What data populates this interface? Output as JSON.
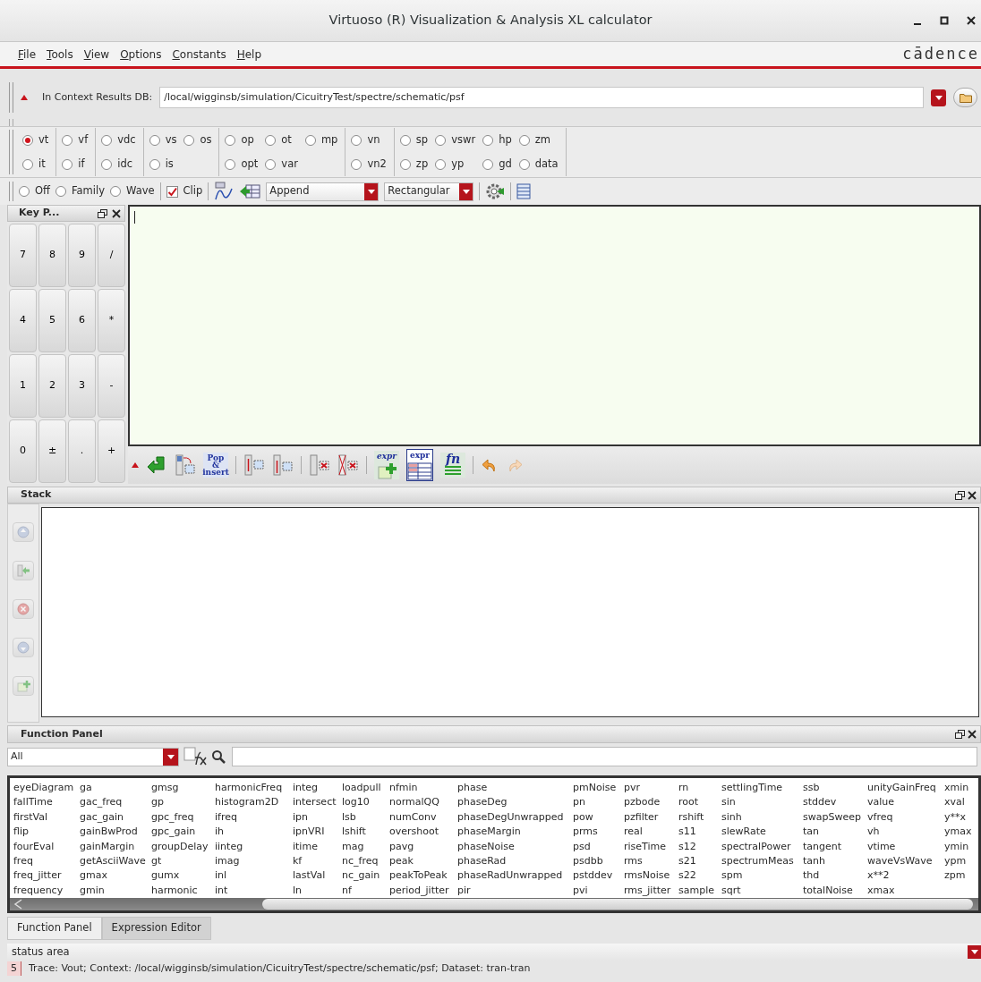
{
  "window": {
    "title": "Virtuoso (R) Visualization & Analysis XL calculator"
  },
  "menu": [
    "File",
    "Tools",
    "View",
    "Options",
    "Constants",
    "Help"
  ],
  "logo": "cādence",
  "context": {
    "label": "In Context Results DB:",
    "value": "/local/wigginsb/simulation/CicuitryTest/spectre/schematic/psf"
  },
  "signal_groups": [
    {
      "rows": [
        [
          {
            "label": "vt",
            "selected": true
          }
        ],
        [
          {
            "label": "it",
            "selected": false
          }
        ]
      ]
    },
    {
      "rows": [
        [
          {
            "label": "vf",
            "selected": false
          }
        ],
        [
          {
            "label": "if",
            "selected": false
          }
        ]
      ]
    },
    {
      "rows": [
        [
          {
            "label": "vdc",
            "selected": false
          }
        ],
        [
          {
            "label": "idc",
            "selected": false
          }
        ]
      ]
    },
    {
      "rows": [
        [
          {
            "label": "vs",
            "selected": false
          },
          {
            "label": "os",
            "selected": false
          }
        ],
        [
          {
            "label": "is",
            "selected": false
          }
        ]
      ]
    },
    {
      "rows": [
        [
          {
            "label": "op",
            "selected": false
          },
          {
            "label": "ot",
            "selected": false
          },
          {
            "label": "mp",
            "selected": false
          }
        ],
        [
          {
            "label": "opt",
            "selected": false
          },
          {
            "label": "var",
            "selected": false
          }
        ]
      ]
    },
    {
      "rows": [
        [
          {
            "label": "vn",
            "selected": false
          }
        ],
        [
          {
            "label": "vn2",
            "selected": false
          }
        ]
      ]
    },
    {
      "rows": [
        [
          {
            "label": "sp",
            "selected": false
          },
          {
            "label": "vswr",
            "selected": false
          },
          {
            "label": "hp",
            "selected": false
          },
          {
            "label": "zm",
            "selected": false
          }
        ],
        [
          {
            "label": "zp",
            "selected": false
          },
          {
            "label": "yp",
            "selected": false
          },
          {
            "label": "gd",
            "selected": false
          },
          {
            "label": "data",
            "selected": false
          }
        ]
      ]
    }
  ],
  "plot_toolbar": {
    "modes": [
      {
        "label": "Off",
        "selected": false
      },
      {
        "label": "Family",
        "selected": false
      },
      {
        "label": "Wave",
        "selected": false
      }
    ],
    "clip": {
      "label": "Clip",
      "checked": true
    },
    "append_mode": "Append",
    "plot_style": "Rectangular"
  },
  "key_panel": {
    "title": "Key P...",
    "keys": [
      "7",
      "8",
      "9",
      "/",
      "4",
      "5",
      "6",
      "*",
      "1",
      "2",
      "3",
      "-",
      "0",
      "±",
      ".",
      "+"
    ]
  },
  "expr_toolbar": {
    "pop_insert": [
      "Pop",
      "&",
      "insert"
    ],
    "expr_labels": [
      "expr",
      "expr"
    ],
    "fn_label": "fn"
  },
  "stack": {
    "title": "Stack",
    "buttons": [
      {
        "kind": "up",
        "disabled": true
      },
      {
        "kind": "push",
        "disabled": true
      },
      {
        "kind": "delete",
        "disabled": true
      },
      {
        "kind": "down",
        "disabled": true
      },
      {
        "kind": "expr",
        "disabled": true
      }
    ]
  },
  "function_panel": {
    "title": "Function Panel",
    "filter": "All",
    "columns": [
      [
        "eyeDiagram",
        "fallTime",
        "firstVal",
        "flip",
        "fourEval",
        "freq",
        "freq_jitter",
        "frequency"
      ],
      [
        "ga",
        "gac_freq",
        "gac_gain",
        "gainBwProd",
        "gainMargin",
        "getAsciiWave",
        "gmax",
        "gmin"
      ],
      [
        "gmsg",
        "gp",
        "gpc_freq",
        "gpc_gain",
        "groupDelay",
        "gt",
        "gumx",
        "harmonic"
      ],
      [
        "harmonicFreq",
        "histogram2D",
        "ifreq",
        "ih",
        "iinteg",
        "imag",
        "inl",
        "int"
      ],
      [
        "integ",
        "intersect",
        "ipn",
        "ipnVRI",
        "itime",
        "kf",
        "lastVal",
        "ln"
      ],
      [
        "loadpull",
        "log10",
        "lsb",
        "lshift",
        "mag",
        "nc_freq",
        "nc_gain",
        "nf"
      ],
      [
        "nfmin",
        "normalQQ",
        "numConv",
        "overshoot",
        "pavg",
        "peak",
        "peakToPeak",
        "period_jitter"
      ],
      [
        "phase",
        "phaseDeg",
        "phaseDegUnwrapped",
        "phaseMargin",
        "phaseNoise",
        "phaseRad",
        "phaseRadUnwrapped",
        "pir"
      ],
      [
        "pmNoise",
        "pn",
        "pow",
        "prms",
        "psd",
        "psdbb",
        "pstddev",
        "pvi"
      ],
      [
        "pvr",
        "pzbode",
        "pzfilter",
        "real",
        "riseTime",
        "rms",
        "rmsNoise",
        "rms_jitter"
      ],
      [
        "rn",
        "root",
        "rshift",
        "s11",
        "s12",
        "s21",
        "s22",
        "sample"
      ],
      [
        "settlingTime",
        "sin",
        "sinh",
        "slewRate",
        "spectralPower",
        "spectrumMeas",
        "spm",
        "sqrt"
      ],
      [
        "ssb",
        "stddev",
        "swapSweep",
        "tan",
        "tangent",
        "tanh",
        "thd",
        "totalNoise"
      ],
      [
        "unityGainFreq",
        "value",
        "vfreq",
        "vh",
        "vtime",
        "waveVsWave",
        "x**2",
        "xmax"
      ],
      [
        "xmin",
        "xval",
        "y**x",
        "ymax",
        "ymin",
        "ypm",
        "zpm"
      ]
    ]
  },
  "tabs": [
    {
      "label": "Function Panel",
      "selected": true
    },
    {
      "label": "Expression Editor",
      "selected": false
    }
  ],
  "status": {
    "label": "status area",
    "line_number": "5",
    "message": "Trace: Vout; Context: /local/wigginsb/simulation/CicuitryTest/spectre/schematic/psf; Dataset: tran-tran"
  }
}
